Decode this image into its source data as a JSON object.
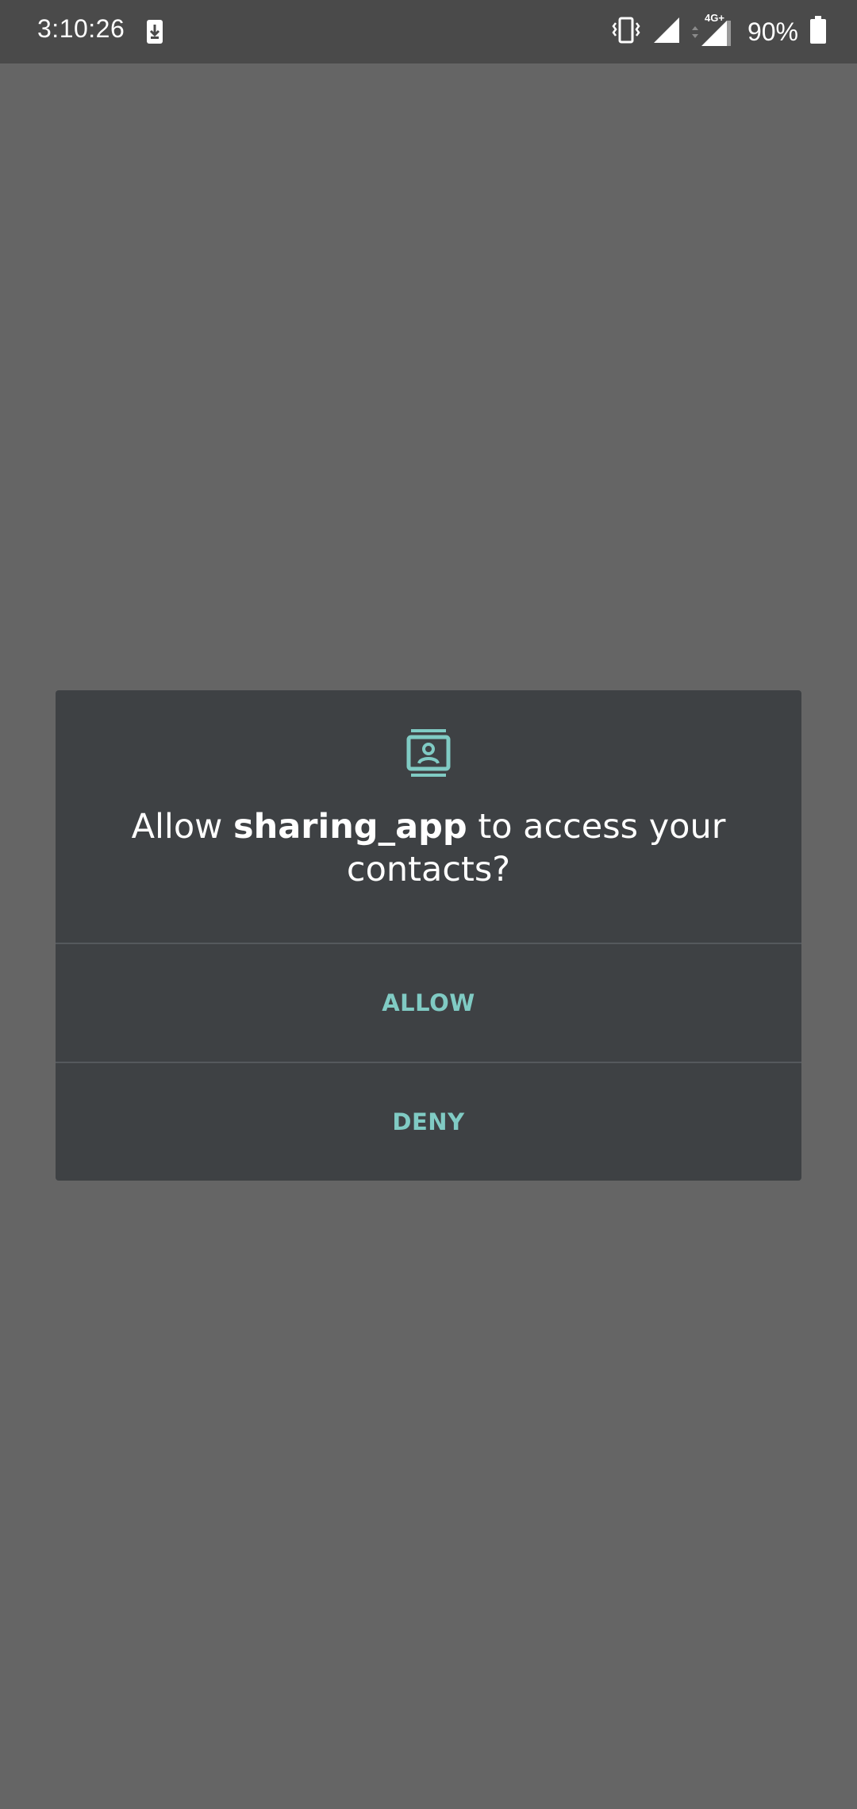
{
  "status_bar": {
    "time": "3:10:26",
    "battery": "90%",
    "network": "4G+",
    "icons": [
      "download-icon",
      "vibrate-icon",
      "signal-icon",
      "signal-4g-icon",
      "battery-icon"
    ]
  },
  "dialog": {
    "icon": "contacts-icon",
    "message_prefix": "Allow ",
    "app_name": "sharing_app",
    "message_suffix": " to access your contacts?",
    "allow_label": "ALLOW",
    "deny_label": "DENY"
  },
  "colors": {
    "scrim": "#656565",
    "status_bar": "#4a4a4a",
    "dialog_bg": "#3e4144",
    "accent": "#80cbc4",
    "divider": "#55595d"
  }
}
